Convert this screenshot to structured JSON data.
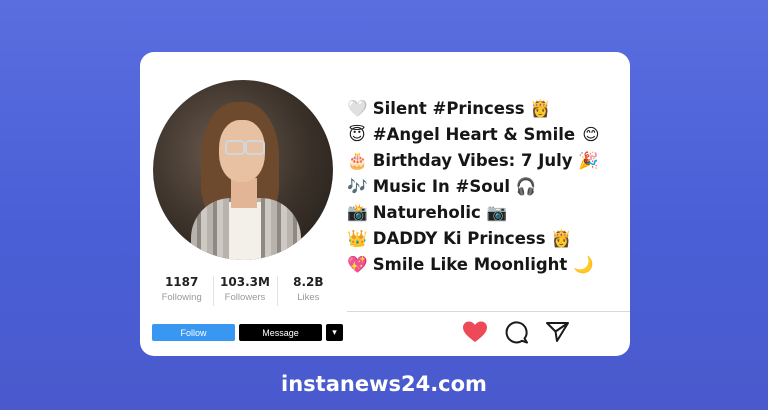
{
  "profile": {
    "stats": [
      {
        "value": "1187",
        "label": "Following"
      },
      {
        "value": "103.3M",
        "label": "Followers"
      },
      {
        "value": "8.2B",
        "label": "Likes"
      }
    ],
    "buttons": {
      "follow": "Follow",
      "message": "Message",
      "more": "▾"
    }
  },
  "bio": [
    {
      "icon_name": "white-heart-icon",
      "icon": "🤍",
      "text": "Silent #Princess",
      "trail_name": "princess-icon",
      "trail": "👸"
    },
    {
      "icon_name": "angel-face-icon",
      "icon": "😇",
      "text": "#Angel Heart & Smile",
      "trail_name": "smiling-face-icon",
      "trail": "😊"
    },
    {
      "icon_name": "birthday-cake-icon",
      "icon": "🎂",
      "text": "Birthday Vibes: 7 July",
      "trail_name": "party-popper-icon",
      "trail": "🎉"
    },
    {
      "icon_name": "music-notes-icon",
      "icon": "🎶",
      "text": "Music In #Soul",
      "trail_name": "headphones-icon",
      "trail": "🎧"
    },
    {
      "icon_name": "camera-flash-icon",
      "icon": "📸",
      "text": "Natureholic",
      "trail_name": "camera-icon",
      "trail": "📷"
    },
    {
      "icon_name": "crown-icon",
      "icon": "👑",
      "text": "DADDY Ki Princess",
      "trail_name": "princess-icon",
      "trail": "👸"
    },
    {
      "icon_name": "sparkling-heart-icon",
      "icon": "💖",
      "text": "Smile Like Moonlight",
      "trail_name": "crescent-moon-icon",
      "trail": "🌙"
    }
  ],
  "actions": [
    "heart-icon",
    "comment-icon",
    "share-icon"
  ],
  "website": "instanews24.com",
  "colors": {
    "follow": "#3897f0",
    "heart": "#ed4956",
    "background": "#5166d8"
  }
}
